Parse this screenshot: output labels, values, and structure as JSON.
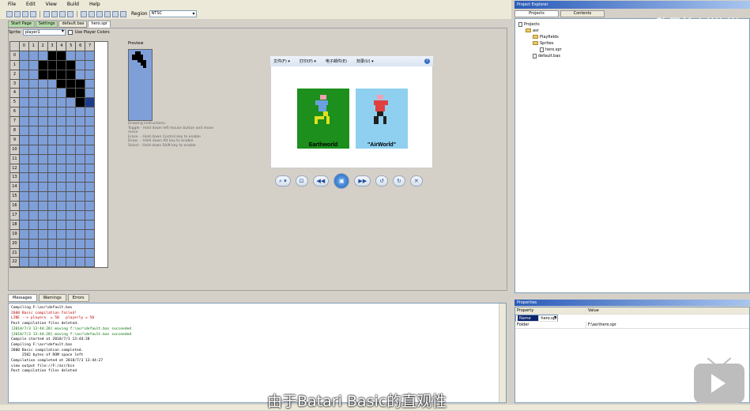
{
  "menu": [
    "File",
    "Edit",
    "View",
    "Build",
    "Help"
  ],
  "toolbar": {
    "region_label": "Region",
    "region_value": "NTSC"
  },
  "doc_tabs": [
    "Start Page",
    "Settings",
    "default.bas",
    "hero.spr"
  ],
  "sprite": {
    "label": "Sprite",
    "value": "player1",
    "use_player_colors": "Use Player Colors",
    "preview_label": "Preview"
  },
  "grid": {
    "columns": [
      "0",
      "1",
      "2",
      "3",
      "4",
      "5",
      "6",
      "7"
    ],
    "rows": [
      "0",
      "1",
      "2",
      "3",
      "4",
      "5",
      "6",
      "7",
      "8",
      "9",
      "10",
      "11",
      "12",
      "13",
      "14",
      "15",
      "16",
      "17",
      "18",
      "19",
      "20",
      "21",
      "22"
    ],
    "on_cells": [
      [
        0,
        3
      ],
      [
        0,
        4
      ],
      [
        1,
        2
      ],
      [
        1,
        3
      ],
      [
        1,
        4
      ],
      [
        1,
        5
      ],
      [
        2,
        2
      ],
      [
        2,
        3
      ],
      [
        2,
        4
      ],
      [
        2,
        5
      ],
      [
        3,
        4
      ],
      [
        3,
        5
      ],
      [
        3,
        6
      ],
      [
        4,
        5
      ],
      [
        4,
        6
      ],
      [
        5,
        6
      ]
    ],
    "current_cell": [
      5,
      7
    ],
    "current_row": 5
  },
  "instructions": "Drawing Instructions:\nToggle - Hold down left mouse button and move\nmove\nErase  - Hold down Control key to enable\nDraw   - Hold down Alt key to enable\nSelect - Hold down Shift key to enable",
  "viewer": {
    "menu": [
      "文件(F) ▾",
      "打印(P) ▾",
      "电子邮件(E)",
      "刻录(U) ▾"
    ],
    "help": "?",
    "cards": [
      {
        "label": "Earthworld",
        "bg": "#1c8f1c"
      },
      {
        "label": "\"AirWorld\"",
        "bg": "#8fd0f0"
      }
    ],
    "controls": [
      "⌕ ▾",
      "⊡",
      "◀◀",
      "▣",
      "▶▶",
      "↺",
      "↻",
      "✕"
    ]
  },
  "output_tabs": [
    "Messages",
    "Warnings",
    "Errors"
  ],
  "output_lines": [
    "Compiling F:\\asr\\default.bas",
    "2600 Basic compilation failed!",
    "LINE --> playerx  = 50   playerly = 50",
    "Post compilation files deleted.",
    "[2018/7/3 13:44:28] moving f:\\asr\\default.bas succeeded",
    "[2018/7/3 13:44:28] moving f:\\asr\\default.bas succeeded",
    "Compile started at 2018/7/3 13:44:28",
    "Compiling F:\\asr\\default.bas",
    "2600 Basic compilation completed.",
    "     2582 bytes of ROM space left",
    "",
    "Compilation completed at 2018/7/3 13:44:27",
    "view output file://F:/asr/bin",
    "Post compilation files deleted"
  ],
  "project_explorer": {
    "title": "Project Explorer",
    "tabs": [
      "Projects",
      "Contents"
    ],
    "tree": [
      {
        "label": "Projects",
        "level": 0,
        "type": "doc"
      },
      {
        "label": "asr",
        "level": 1,
        "type": "folder"
      },
      {
        "label": "Playfields",
        "level": 2,
        "type": "folder"
      },
      {
        "label": "Sprites",
        "level": 2,
        "type": "folder"
      },
      {
        "label": "hero.spr",
        "level": 3,
        "type": "doc"
      },
      {
        "label": "default.bas",
        "level": 2,
        "type": "doc"
      }
    ]
  },
  "properties": {
    "title": "Properties",
    "headers": [
      "Property",
      "Value"
    ],
    "rows": [
      [
        "Name",
        "hero.spr"
      ],
      [
        "Folder",
        "F:\\asr\\hero.spr"
      ]
    ]
  },
  "watermark": "敖厂长 bilibili",
  "subtitle": "由于Batari Basic的直观性"
}
